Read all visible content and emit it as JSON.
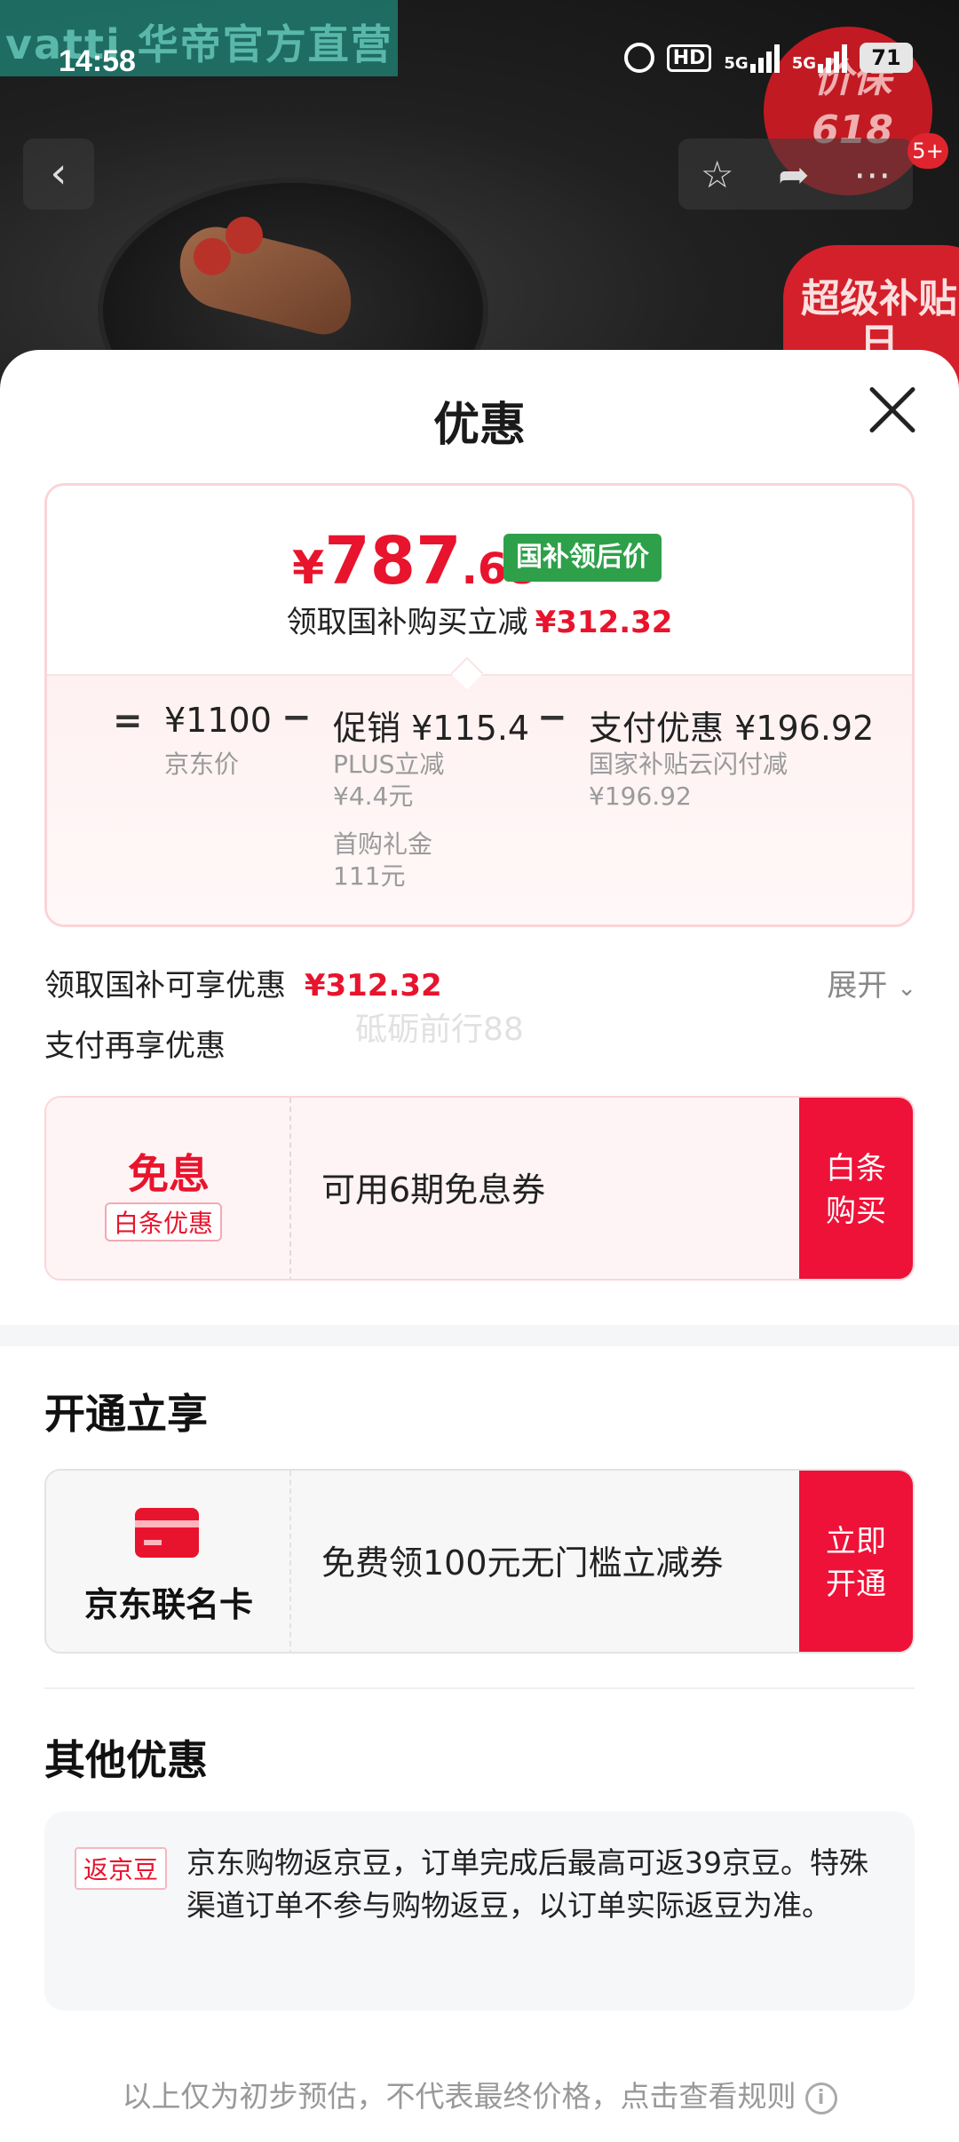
{
  "background": {
    "brand_logo_text": "vatti 华帝官方直营",
    "promo_bubble": "价保618",
    "super_bubble": "超级补贴日"
  },
  "status_bar": {
    "time": "14:58",
    "hd": "HD",
    "signal1": "5G",
    "signal2": "5G",
    "battery": "71"
  },
  "nav": {
    "back_icon": "chevron-left-icon",
    "cart_badge": "5+"
  },
  "sheet": {
    "title": "优惠",
    "price": {
      "currency": "¥",
      "integer": "787",
      "decimal": ".68",
      "tag": "国补领后价",
      "save_label": "领取国补购买立减",
      "save_amount": "¥312.32"
    },
    "breakdown": {
      "eq": "=",
      "minus": "−",
      "jd_price": "¥1100",
      "jd_price_label": "京东价",
      "promo_label": "促销",
      "promo_amount": "¥115.4",
      "plus_label": "PLUS立减",
      "plus_amount": "¥4.4元",
      "first_label": "首购礼金",
      "first_amount": "111元",
      "pay_label": "支付优惠",
      "pay_amount": "¥196.92",
      "pay_desc": "国家补贴云闪付减",
      "pay_desc_amount": "¥196.92"
    },
    "subsidy_row": {
      "label": "领取国补可享优惠",
      "amount": "¥312.32",
      "expand": "展开"
    },
    "pay_again_label": "支付再享优惠",
    "watermark": "砥砺前行88",
    "baitiao_coupon": {
      "title": "免息",
      "tag": "白条优惠",
      "desc": "可用6期免息券",
      "button": "白条\n购买"
    },
    "open_section": {
      "title": "开通立享",
      "card_name": "京东联名卡",
      "desc": "免费领100元无门槛立减券",
      "button": "立即\n开通"
    },
    "other_section": {
      "title": "其他优惠",
      "tag": "返京豆",
      "text": "京东购物返京豆，订单完成后最高可返39京豆。特殊渠道订单不参与购物返豆，以订单实际返豆为准。"
    },
    "footer_note": "以上仅为初步预估，不代表最终价格，点击查看规则"
  },
  "colors": {
    "accent_red": "#e8142d",
    "button_red": "#ee1238",
    "tag_green": "#2ea04a"
  }
}
